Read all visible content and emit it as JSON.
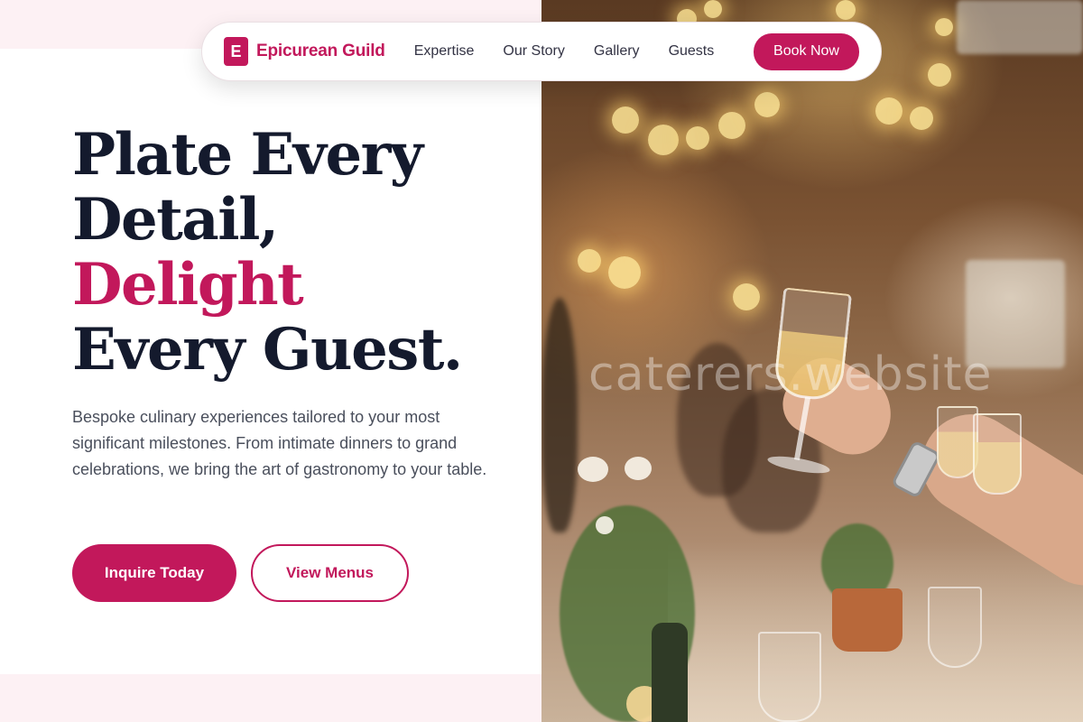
{
  "nav": {
    "brand_initial": "E",
    "brand_name": "Epicurean Guild",
    "links": [
      "Expertise",
      "Our Story",
      "Gallery",
      "Guests"
    ],
    "cta_label": "Book Now"
  },
  "hero": {
    "headline_line1": "Plate Every",
    "headline_line2": "Detail,",
    "headline_accent": "Delight",
    "headline_line4": "Every Guest.",
    "lede": "Bespoke culinary experiences tailored to your most significant milestones. From intimate dinners to grand celebrations, we bring the art of gastronomy to your table.",
    "primary_cta": "Inquire Today",
    "secondary_cta": "View Menus"
  },
  "photo": {
    "watermark": "caterers.website"
  },
  "colors": {
    "accent": "#c2185b",
    "heading": "#141a2d",
    "body_text": "#4a4f5c",
    "band": "#fdf1f4"
  }
}
